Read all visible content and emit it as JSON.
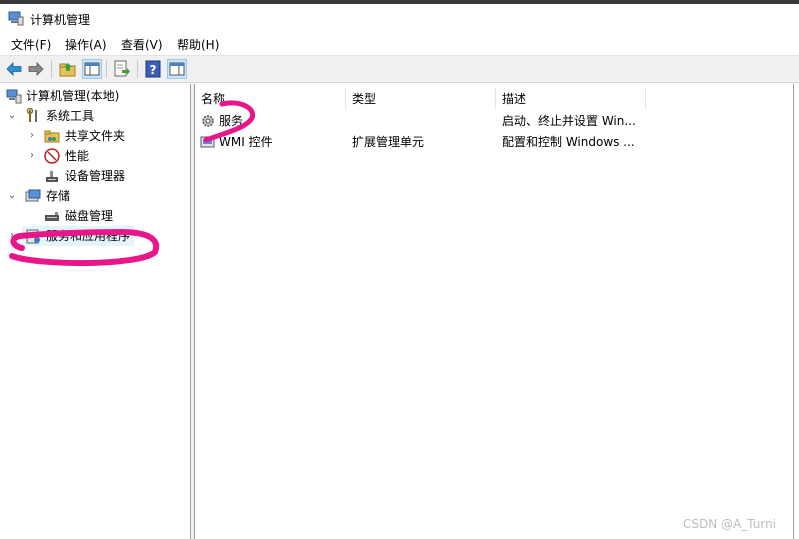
{
  "window": {
    "title": "计算机管理",
    "accent_color": "#2f6dbd"
  },
  "menu": [
    "文件(F)",
    "操作(A)",
    "查看(V)",
    "帮助(H)"
  ],
  "toolbar": {
    "icons": [
      "back-arrow-icon",
      "forward-arrow-icon",
      "folder-up-icon",
      "show-hide-tree-icon",
      "export-list-icon",
      "help-icon",
      "show-action-pane-icon"
    ]
  },
  "tree": {
    "root": "计算机管理(本地)",
    "system_tools": "系统工具",
    "shared_folders": "共享文件夹",
    "performance": "性能",
    "device_manager": "设备管理器",
    "storage": "存储",
    "disk_management": "磁盘管理",
    "services_apps": "服务和应用程序"
  },
  "list": {
    "columns": [
      "名称",
      "类型",
      "描述"
    ],
    "rows": [
      {
        "name": "服务",
        "type": "",
        "desc": "启动、终止并设置 Win..."
      },
      {
        "name": "WMI 控件",
        "type": "扩展管理单元",
        "desc": "配置和控制 Windows ..."
      }
    ]
  },
  "annotations": {
    "marker_color": "#e8168a"
  },
  "watermark": "CSDN @A_Turni"
}
